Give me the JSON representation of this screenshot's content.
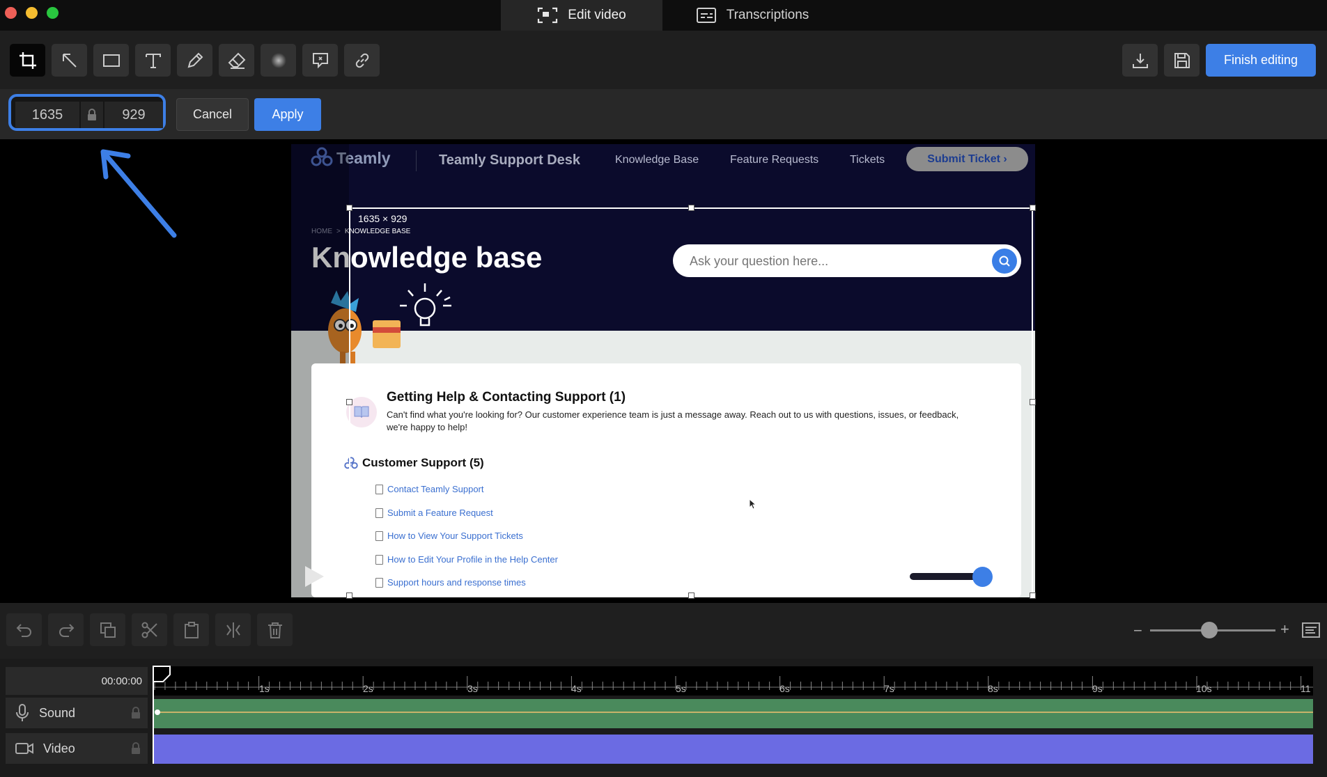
{
  "window": {
    "tabs": [
      {
        "label": "Edit video",
        "icon": "screen-capture-icon",
        "active": true
      },
      {
        "label": "Transcriptions",
        "icon": "subtitles-icon",
        "active": false
      }
    ]
  },
  "toolbar": {
    "tools": [
      "crop-icon",
      "arrow-icon",
      "rectangle-icon",
      "text-icon",
      "pencil-icon",
      "eraser-icon",
      "blur-icon",
      "callout-icon",
      "link-icon"
    ],
    "finish_label": "Finish editing"
  },
  "crop": {
    "width": "1635",
    "height": "929",
    "size_label": "1635 × 929",
    "cancel_label": "Cancel",
    "apply_label": "Apply"
  },
  "preview": {
    "brand": "Teamly",
    "site_title": "Teamly Support Desk",
    "nav": [
      "Knowledge Base",
      "Feature Requests",
      "Tickets"
    ],
    "submit_ticket": "Submit Ticket ›",
    "breadcrumb_home": "HOME",
    "breadcrumb_sep": ">",
    "breadcrumb_current": "KNOWLEDGE BASE",
    "heading": "Knowledge base",
    "search_placeholder": "Ask your question here...",
    "section1_title": "Getting Help & Contacting Support (1)",
    "section1_desc_line1": "Can't find what you're looking for? Our customer experience team is just a message away. Reach out to us with questions, issues, or feedback,",
    "section1_desc_line2": "we're happy to help!",
    "section2_title": "Customer Support (5)",
    "links": [
      "Contact Teamly Support",
      "Submit a Feature Request",
      "How to View Your Support Tickets",
      "How to Edit Your Profile in the Help Center",
      "Support hours and response times"
    ]
  },
  "timeline": {
    "time": "00:00:00",
    "ruler_labels": [
      "1s",
      "2s",
      "3s",
      "4s",
      "5s",
      "6s",
      "7s",
      "8s",
      "9s",
      "10s",
      "11"
    ],
    "tracks": [
      {
        "label": "Sound",
        "icon": "microphone-icon"
      },
      {
        "label": "Video",
        "icon": "video-camera-icon"
      }
    ],
    "zoom_minus": "−",
    "zoom_plus": "+"
  },
  "colors": {
    "accent": "#3d7fe6",
    "sound_track": "#4a8a5c",
    "video_track": "#6b6be3"
  }
}
